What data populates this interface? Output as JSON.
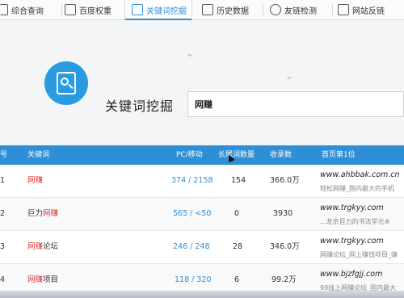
{
  "tabs": [
    {
      "label": "综合查询",
      "active": false,
      "icon": "home-icon"
    },
    {
      "label": "百度权重",
      "active": false,
      "icon": "weight-icon"
    },
    {
      "label": "关键词挖掘",
      "active": true,
      "icon": "keyword-icon"
    },
    {
      "label": "历史数据",
      "active": false,
      "icon": "history-icon"
    },
    {
      "label": "友链检测",
      "active": false,
      "icon": "link-icon"
    },
    {
      "label": "网站反链",
      "active": false,
      "icon": "backlink-icon"
    }
  ],
  "hero": {
    "title": "关键词挖掘",
    "search_value": "网赚",
    "logo_icon": "keyword-search-doc-icon"
  },
  "table": {
    "headers": [
      "号",
      "关键词",
      "PC/移动",
      "长尾词数量",
      "收录数",
      "首页第1位"
    ],
    "rows": [
      {
        "index": "1",
        "kw_pre": "",
        "kw_hi": "网赚",
        "kw_post": "",
        "pc_mobile": "374 / 2158",
        "longtail": "154",
        "indexed": "366.0万",
        "site": "www.ahbbak.com.cn",
        "desc": "轻松网赚_国内最大的手机"
      },
      {
        "index": "2",
        "kw_pre": "巨力",
        "kw_hi": "网赚",
        "kw_post": "",
        "pc_mobile": "565 / <50",
        "longtail": "0",
        "indexed": "3930",
        "site": "www.trgkyy.com",
        "desc": "...龙余巨力的书法学元⑧"
      },
      {
        "index": "3",
        "kw_pre": "",
        "kw_hi": "网赚",
        "kw_post": "论坛",
        "pc_mobile": "246 / 248",
        "longtail": "28",
        "indexed": "346.0万",
        "site": "www.trgkyy.com",
        "desc": "网赚论坛_网上赚钱项目_赚"
      },
      {
        "index": "4",
        "kw_pre": "",
        "kw_hi": "网赚",
        "kw_post": "项目",
        "pc_mobile": "118 / 320",
        "longtail": "6",
        "indexed": "99.2万",
        "site": "www.bjzfgjj.com",
        "desc": "99线上网赚论坛_国内最大"
      }
    ]
  },
  "colors": {
    "accent": "#2f8fd6",
    "highlight": "#e03030"
  }
}
